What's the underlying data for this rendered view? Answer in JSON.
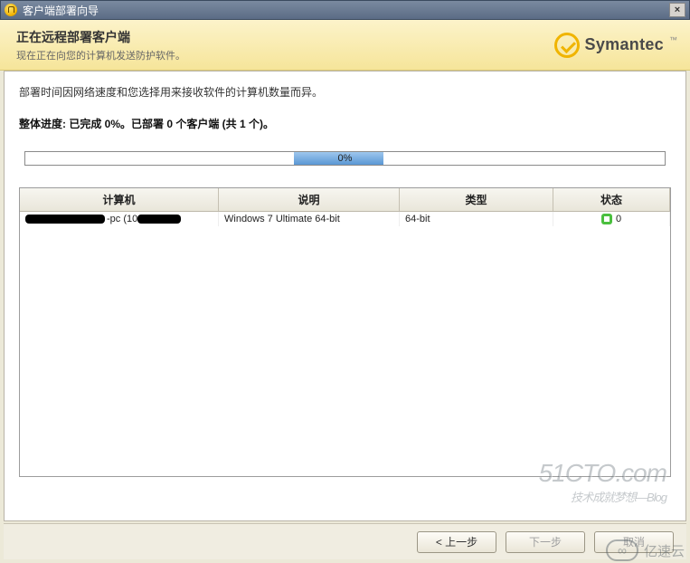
{
  "window": {
    "title": "客户端部署向导"
  },
  "header": {
    "title": "正在远程部署客户端",
    "subtitle": "现在正在向您的计算机发送防护软件。",
    "brand": "Symantec",
    "brand_tm": "™"
  },
  "body": {
    "note": "部署时间因网络速度和您选择用来接收软件的计算机数量而异。",
    "progress_summary": "整体进度: 已完成 0%。已部署 0 个客户端 (共 1 个)。",
    "progress_pct": "0%"
  },
  "grid": {
    "headers": {
      "computer": "计算机",
      "desc": "说明",
      "type": "类型",
      "status": "状态"
    },
    "rows": [
      {
        "computer_suffix": "-pc (10",
        "desc": "Windows 7 Ultimate 64-bit",
        "type": "64-bit",
        "status_value": "0"
      }
    ]
  },
  "footer": {
    "back": "< 上一步",
    "next": "下一步",
    "cancel": "取消"
  },
  "watermarks": {
    "w1_main": "51CTO.com",
    "w1_sub": "技术成就梦想—Blog",
    "w2": "亿速云"
  }
}
